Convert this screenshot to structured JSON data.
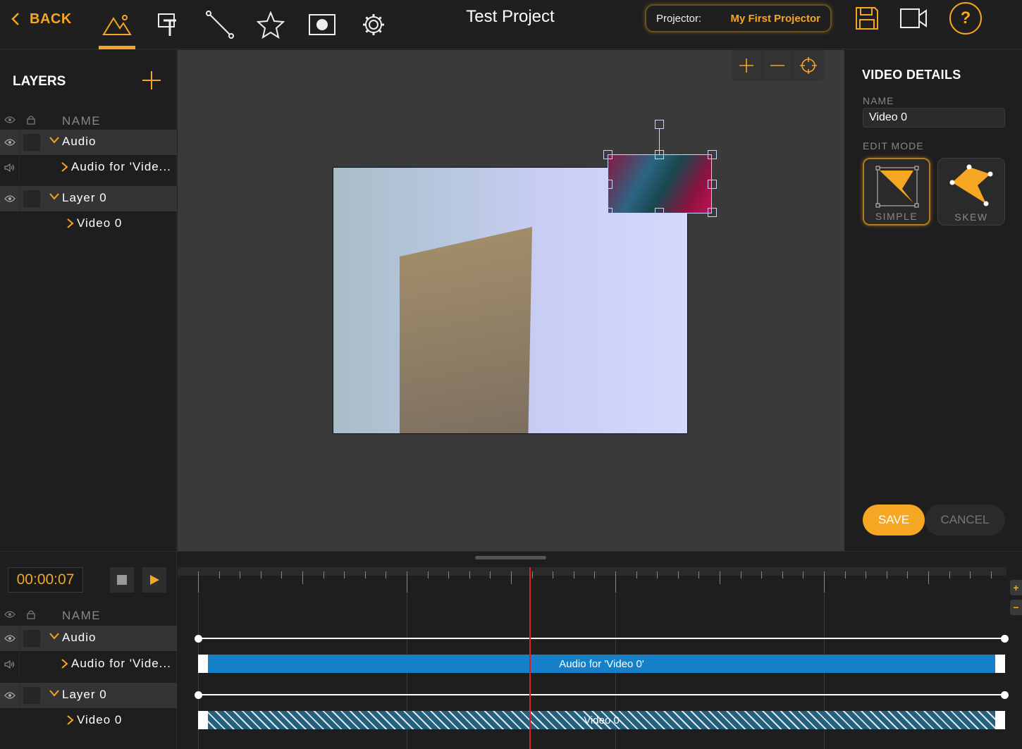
{
  "topbar": {
    "back_label": "BACK",
    "project_title": "Test Project",
    "projector_label": "Projector:",
    "projector_name": "My First Projector",
    "help_label": "?",
    "tools": [
      "mountain-icon",
      "text-tool-icon",
      "line-tool-icon",
      "star-icon",
      "mask-icon",
      "gear-icon"
    ],
    "active_tool": "mountain-icon",
    "accent_color": "#f5a623"
  },
  "layers": {
    "title": "LAYERS",
    "header_name": "NAME",
    "tree": [
      {
        "type": "group",
        "label": "Audio",
        "children": [
          {
            "label": "Audio for 'Vide..."
          }
        ]
      },
      {
        "type": "group",
        "label": "Layer 0",
        "children": [
          {
            "label": "Video 0"
          }
        ]
      }
    ]
  },
  "canvas": {
    "zoom_controls": [
      "plus-icon",
      "minus-icon",
      "crosshair-icon"
    ]
  },
  "details": {
    "title": "VIDEO DETAILS",
    "name_label": "NAME",
    "name_value": "Video 0",
    "edit_mode_label": "EDIT MODE",
    "modes": [
      "SIMPLE",
      "SKEW"
    ],
    "active_mode": "SIMPLE",
    "save_label": "SAVE",
    "cancel_label": "CANCEL"
  },
  "timeline": {
    "timecode": "00:00:07",
    "header_name": "NAME",
    "tree": [
      {
        "type": "group",
        "label": "Audio",
        "children": [
          {
            "label": "Audio for 'Vide..."
          }
        ]
      },
      {
        "type": "group",
        "label": "Layer 0",
        "children": [
          {
            "label": "Video 0"
          }
        ]
      }
    ],
    "clips": {
      "audio_label": "Audio for 'Video 0'",
      "video_label": "Video 0"
    },
    "zoom_in": "+",
    "zoom_out": "−",
    "playhead_color": "#e02020",
    "audio_clip_color": "#1580c8"
  }
}
